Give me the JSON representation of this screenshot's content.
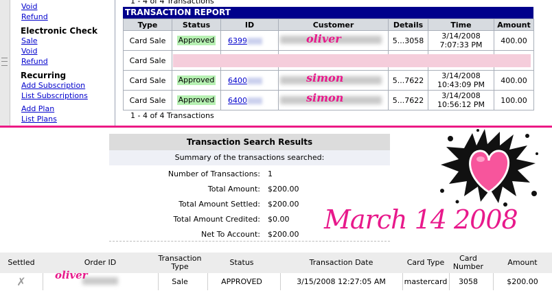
{
  "sidebar": {
    "links_top": [
      {
        "label": "Void"
      },
      {
        "label": "Refund"
      }
    ],
    "electronic_check": {
      "heading": "Electronic Check",
      "items": [
        {
          "label": "Sale"
        },
        {
          "label": "Void"
        },
        {
          "label": "Refund"
        }
      ]
    },
    "recurring": {
      "heading": "Recurring",
      "items": [
        {
          "label": "Add Subscription"
        },
        {
          "label": "List Subscriptions"
        },
        {
          "label": "Add Plan"
        },
        {
          "label": "List Plans"
        }
      ]
    }
  },
  "report": {
    "pager_top": "1 - 4 of 4 Transactions",
    "pager_bottom": "1 - 4 of 4 Transactions",
    "title": "TRANSACTION REPORT",
    "columns": [
      "Type",
      "Status",
      "ID",
      "Customer",
      "Details",
      "Time",
      "Amount"
    ],
    "rows": [
      {
        "type": "Card Sale",
        "status": "Approved",
        "id": "6399",
        "customer": "oliver",
        "details": "5...3058",
        "time_date": "3/14/2008",
        "time_clock": "7:07:33 PM",
        "amount": "400.00"
      },
      {
        "type": "Card Sale",
        "status": "",
        "id": "",
        "customer": "",
        "details": "",
        "time_date": "",
        "time_clock": "",
        "amount": ""
      },
      {
        "type": "Card Sale",
        "status": "Approved",
        "id": "6400",
        "customer": "simon",
        "details": "5...7622",
        "time_date": "3/14/2008",
        "time_clock": "10:43:09 PM",
        "amount": "400.00"
      },
      {
        "type": "Card Sale",
        "status": "Approved",
        "id": "6400",
        "customer": "simon",
        "details": "5...7622",
        "time_date": "3/14/2008",
        "time_clock": "10:56:12 PM",
        "amount": "100.00"
      }
    ]
  },
  "summary": {
    "title": "Transaction Search Results",
    "subtitle": "Summary of the transactions searched:",
    "rows": [
      {
        "label": "Number of Transactions:",
        "value": "1"
      },
      {
        "label": "Total Amount:",
        "value": "$200.00"
      },
      {
        "label": "Total Amount Settled:",
        "value": "$200.00"
      },
      {
        "label": "Total Amount Credited:",
        "value": "$0.00"
      },
      {
        "label": "Net To Account:",
        "value": "$200.00"
      }
    ]
  },
  "overlay": {
    "date_text": "March 14 2008",
    "heart_icon": "heart-splat-icon",
    "pink_color": "#e8198b"
  },
  "orders": {
    "columns": {
      "settled": "Settled",
      "order_id": "Order ID",
      "tx_type": "Transaction Type",
      "status": "Status",
      "tx_date": "Transaction Date",
      "card_type": "Card Type",
      "card_number": "Card Number",
      "amount": "Amount"
    },
    "row": {
      "settled_icon": "x-mark-icon",
      "order_id": "oliver",
      "tx_type": "Sale",
      "status": "APPROVED",
      "tx_date": "3/15/2008 12:27:05 AM",
      "card_type": "mastercard",
      "card_number": "3058",
      "amount": "$200.00"
    }
  },
  "colors": {
    "report_header_bg": "#00008b",
    "approved_bg": "#b6f0b2",
    "divider": "#ec1a85"
  }
}
